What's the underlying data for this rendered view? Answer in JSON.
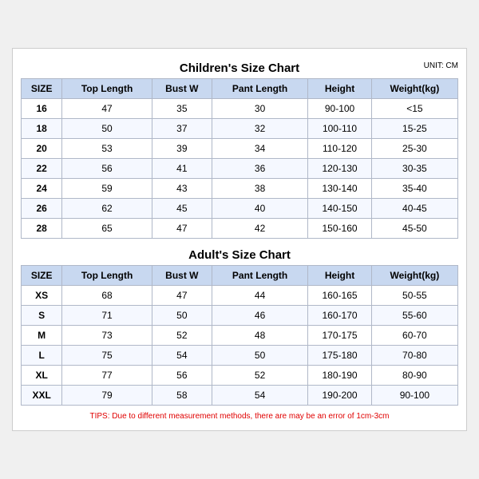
{
  "children_section": {
    "title": "Children's Size Chart",
    "unit": "UNIT: CM",
    "headers": [
      "SIZE",
      "Top Length",
      "Bust W",
      "Pant Length",
      "Height",
      "Weight(kg)"
    ],
    "rows": [
      [
        "16",
        "47",
        "35",
        "30",
        "90-100",
        "<15"
      ],
      [
        "18",
        "50",
        "37",
        "32",
        "100-110",
        "15-25"
      ],
      [
        "20",
        "53",
        "39",
        "34",
        "110-120",
        "25-30"
      ],
      [
        "22",
        "56",
        "41",
        "36",
        "120-130",
        "30-35"
      ],
      [
        "24",
        "59",
        "43",
        "38",
        "130-140",
        "35-40"
      ],
      [
        "26",
        "62",
        "45",
        "40",
        "140-150",
        "40-45"
      ],
      [
        "28",
        "65",
        "47",
        "42",
        "150-160",
        "45-50"
      ]
    ]
  },
  "adults_section": {
    "title": "Adult's Size Chart",
    "headers": [
      "SIZE",
      "Top Length",
      "Bust W",
      "Pant Length",
      "Height",
      "Weight(kg)"
    ],
    "rows": [
      [
        "XS",
        "68",
        "47",
        "44",
        "160-165",
        "50-55"
      ],
      [
        "S",
        "71",
        "50",
        "46",
        "160-170",
        "55-60"
      ],
      [
        "M",
        "73",
        "52",
        "48",
        "170-175",
        "60-70"
      ],
      [
        "L",
        "75",
        "54",
        "50",
        "175-180",
        "70-80"
      ],
      [
        "XL",
        "77",
        "56",
        "52",
        "180-190",
        "80-90"
      ],
      [
        "XXL",
        "79",
        "58",
        "54",
        "190-200",
        "90-100"
      ]
    ]
  },
  "tips": "TIPS: Due to different measurement methods, there are may be an error of 1cm-3cm"
}
